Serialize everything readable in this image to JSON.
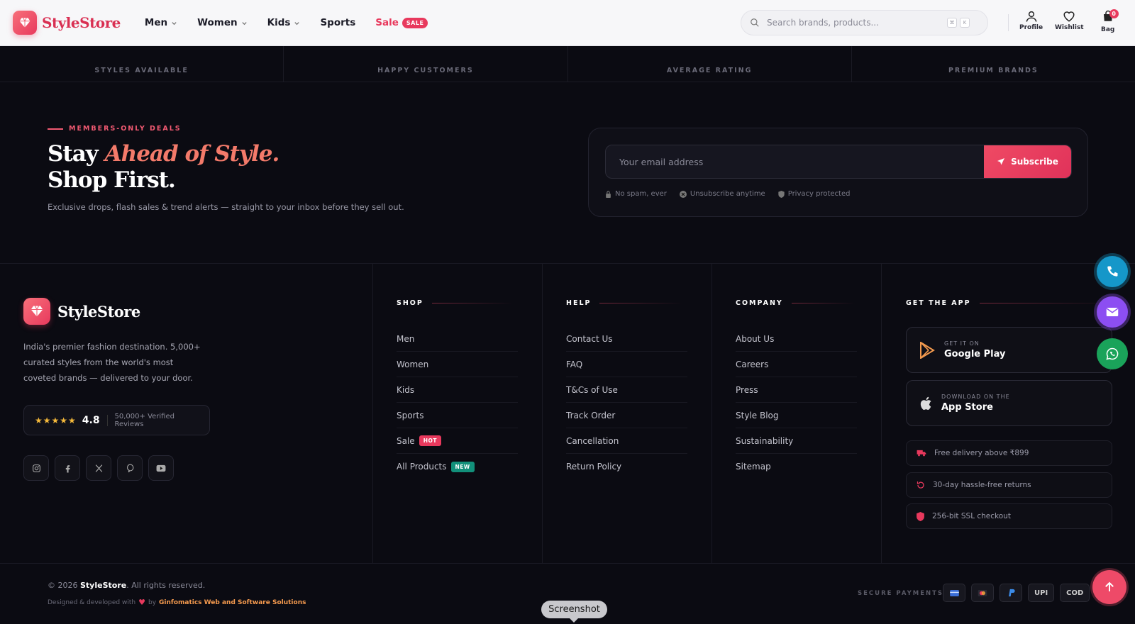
{
  "header": {
    "brand": "StyleStore",
    "nav": [
      {
        "label": "Men",
        "has_menu": true
      },
      {
        "label": "Women",
        "has_menu": true
      },
      {
        "label": "Kids",
        "has_menu": true
      },
      {
        "label": "Sports",
        "has_menu": false
      }
    ],
    "sale": {
      "label": "Sale",
      "badge": "SALE"
    },
    "search": {
      "placeholder": "Search brands, products...",
      "shortcut": [
        "⌘",
        "K"
      ]
    },
    "actions": [
      {
        "label": "Profile",
        "icon": "user-icon"
      },
      {
        "label": "Wishlist",
        "icon": "heart-icon"
      },
      {
        "label": "Bag",
        "icon": "bag-icon",
        "count": "0"
      }
    ]
  },
  "stats": [
    "STYLES AVAILABLE",
    "HAPPY CUSTOMERS",
    "AVERAGE RATING",
    "PREMIUM BRANDS"
  ],
  "newsletter": {
    "eyebrow": "MEMBERS-ONLY DEALS",
    "headline_1": "Stay ",
    "headline_accent": "Ahead of Style.",
    "headline_2": "Shop First.",
    "subtext": "Exclusive drops, flash sales & trend alerts — straight to your inbox before they sell out.",
    "email_placeholder": "Your email address",
    "button": "Subscribe",
    "trust": [
      "No spam, ever",
      "Unsubscribe anytime",
      "Privacy protected"
    ]
  },
  "footer": {
    "brand": "StyleStore",
    "description": "India's premier fashion destination. 5,000+ curated styles from the world's most coveted brands — delivered to your door.",
    "rating": {
      "stars": "★★★★★",
      "score": "4.8",
      "reviews": "50,000+ Verified Reviews"
    },
    "socials": [
      "instagram-icon",
      "facebook-icon",
      "x-icon",
      "pinterest-icon",
      "youtube-icon"
    ],
    "shop": {
      "heading": "SHOP",
      "links": [
        {
          "label": "Men"
        },
        {
          "label": "Women"
        },
        {
          "label": "Kids"
        },
        {
          "label": "Sports"
        },
        {
          "label": "Sale",
          "tag": "HOT"
        },
        {
          "label": "All Products",
          "tag": "NEW"
        }
      ]
    },
    "help": {
      "heading": "HELP",
      "links": [
        "Contact Us",
        "FAQ",
        "T&Cs of Use",
        "Track Order",
        "Cancellation",
        "Return Policy"
      ]
    },
    "company": {
      "heading": "COMPANY",
      "links": [
        "About Us",
        "Careers",
        "Press",
        "Style Blog",
        "Sustainability",
        "Sitemap"
      ]
    },
    "app": {
      "heading": "GET THE APP",
      "google": {
        "small": "GET IT ON",
        "big": "Google Play"
      },
      "apple": {
        "small": "DOWNLOAD ON THE",
        "big": "App Store"
      },
      "perks": [
        "Free delivery above ₹899",
        "30-day hassle-free returns",
        "256-bit SSL checkout"
      ]
    }
  },
  "bottom": {
    "copyright_pre": "© 2026 ",
    "copyright_brand": "StyleStore",
    "copyright_post": ". All rights reserved.",
    "designed_pre": "Designed & developed with",
    "designed_by": "by",
    "designer": "Ginfomatics Web and Software Solutions",
    "secure_label": "SECURE PAYMENTS",
    "payments": [
      "UPI",
      "COD"
    ]
  },
  "tooltip": "Screenshot",
  "colors": {
    "accent": "#e8395d",
    "background": "#0b0b12",
    "call": "#1597c9",
    "mail": "#8c4ef2",
    "whatsapp": "#1aa35a"
  }
}
